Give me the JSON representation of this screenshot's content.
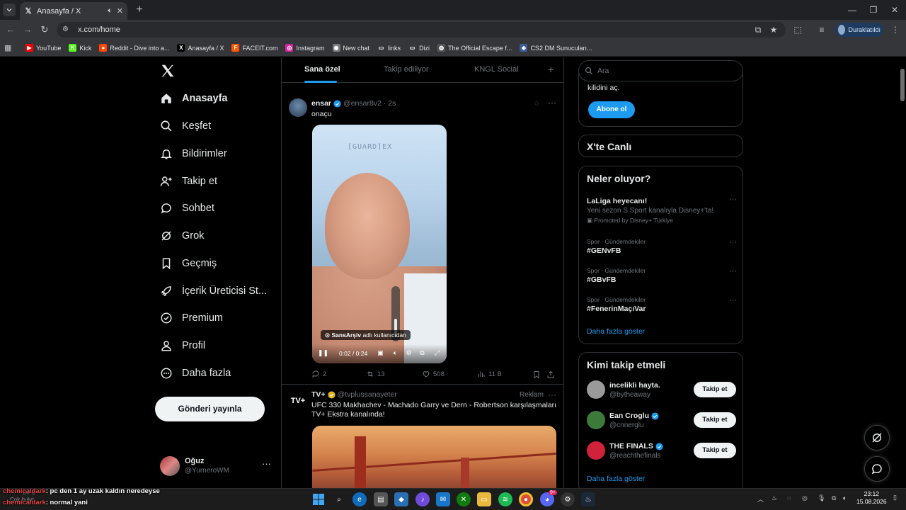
{
  "browser": {
    "tab_title": "Anasayfa / X",
    "url": "x.com/home",
    "profile_label": "Duraklatıldı",
    "bookmarks": [
      {
        "label": "YouTube",
        "color": "#ff0000",
        "glyph": "▶"
      },
      {
        "label": "Kick",
        "color": "#53fc18",
        "glyph": "K"
      },
      {
        "label": "Reddit - Dive into a...",
        "color": "#ff4500",
        "glyph": "●"
      },
      {
        "label": "Anasayfa / X",
        "color": "#000000",
        "glyph": "X"
      },
      {
        "label": "FACEIT.com",
        "color": "#ff5500",
        "glyph": "F"
      },
      {
        "label": "Instagram",
        "color": "#d6249f",
        "glyph": "◎"
      },
      {
        "label": "New chat",
        "color": "#777777",
        "glyph": "◉"
      },
      {
        "label": "links",
        "color": "#35363a",
        "glyph": "▭"
      },
      {
        "label": "Dizi",
        "color": "#35363a",
        "glyph": "▭"
      },
      {
        "label": "The Official Escape f...",
        "color": "#555555",
        "glyph": "◍"
      },
      {
        "label": "CS2 DM Sunucuları...",
        "color": "#3a5a9a",
        "glyph": "◈"
      }
    ]
  },
  "nav": {
    "items": [
      {
        "label": "Anasayfa",
        "icon": "home-icon"
      },
      {
        "label": "Keşfet",
        "icon": "search-icon"
      },
      {
        "label": "Bildirimler",
        "icon": "bell-icon"
      },
      {
        "label": "Takip et",
        "icon": "add-user-icon"
      },
      {
        "label": "Sohbet",
        "icon": "chat-icon"
      },
      {
        "label": "Grok",
        "icon": "grok-icon"
      },
      {
        "label": "Geçmiş",
        "icon": "bookmark-icon"
      },
      {
        "label": "İçerik Üreticisi St...",
        "icon": "rocket-icon"
      },
      {
        "label": "Premium",
        "icon": "verified-icon"
      },
      {
        "label": "Profil",
        "icon": "person-icon"
      },
      {
        "label": "Daha fazla",
        "icon": "more-circle-icon"
      }
    ],
    "post_button": "Gönderi yayınla",
    "account": {
      "name": "Oğuz",
      "handle": "@YurneroWM"
    }
  },
  "feed": {
    "tabs": [
      "Sana özel",
      "Takip ediliyor",
      "KNGL Social"
    ],
    "posts": [
      {
        "name": "ensar",
        "handle": "@ensar8v2",
        "time": "· 2s",
        "text": "onaçu",
        "video": {
          "wall_text": "[GUARD]EX",
          "label_bold": "SansArşiv",
          "label_rest": " adlı kullanıcıdan",
          "time": "0:02 / 0:24",
          "volume": 0.4
        },
        "stats": {
          "replies": "2",
          "reposts": "13",
          "likes": "508",
          "views": "11 B"
        }
      },
      {
        "name": "TV+",
        "handle": "@tvplussanayeter",
        "ad_label": "Reklam",
        "text": "UFC 330 Makhachev - Machado Garry ve Dern - Robertson karşılaşmaları TV+ Ekstra kanalında!"
      }
    ]
  },
  "sidebar": {
    "search_placeholder": "Ara",
    "premium_text": "kilidini aç.",
    "subscribe_button": "Abone ol",
    "live_title": "X'te Canlı",
    "trends_title": "Neler oluyor?",
    "trends": [
      {
        "title": "LaLiga heyecanı!",
        "sub": "Yeni sezon S Sport kanalıyla Disney+'ta!",
        "promo": "Promoted by Disney+ Türkiye"
      },
      {
        "meta": "Spor · Gündemdekiler",
        "title": "#GENvFB"
      },
      {
        "meta": "Spor · Gündemdekiler",
        "title": "#GBvFB"
      },
      {
        "meta": "Spor · Gündemdekiler",
        "title": "#FenerinMaçıVar"
      }
    ],
    "show_more": "Daha fazla göster",
    "who_title": "Kimi takip etmeli",
    "who": [
      {
        "name": "incelikli hayta.",
        "handle": "@bytheaway",
        "verified": false,
        "avatar": "#9a9a9a"
      },
      {
        "name": "Ean Croglu",
        "handle": "@cnnerglu",
        "verified": true,
        "avatar": "#3c7a3a"
      },
      {
        "name": "THE FINALS",
        "handle": "@reachthefinals",
        "verified": true,
        "avatar": "#d0223b"
      }
    ],
    "follow_button": "Takip et"
  },
  "overlay": {
    "line1_user": "chemicaldark",
    "line1_text": ": pc den 1 ay uzak kaldın neredeyse",
    "line2_user": "chemicaldark",
    "line2_text": ": normal yani",
    "weather_temp": "24°C",
    "weather_desc": "Çok bulut"
  },
  "taskbar": {
    "time": "23:12",
    "date": "15.08.2026",
    "discord_badge": "9+"
  }
}
